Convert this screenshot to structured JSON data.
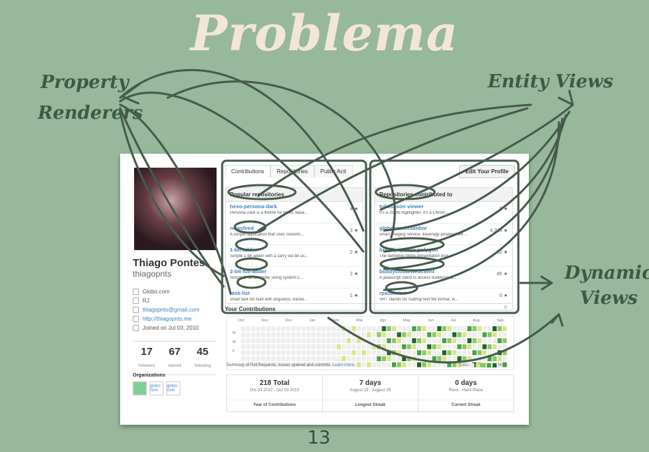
{
  "slide": {
    "title": "Problema",
    "page_number": "13",
    "annotations": {
      "property_renderers": [
        "Property",
        "Renderers"
      ],
      "entity_views": "Entity Views",
      "dynamic_views": [
        "Dynamic",
        "Views"
      ]
    }
  },
  "profile": {
    "name": "Thiago Pontes",
    "username": "thiagopnts",
    "details": [
      {
        "icon": "organization-icon",
        "text": "Globo.com",
        "link": false
      },
      {
        "icon": "location-icon",
        "text": "RJ",
        "link": false
      },
      {
        "icon": "mail-icon",
        "text": "thiagopnts@gmail.com",
        "link": true
      },
      {
        "icon": "link-icon",
        "text": "http://thiagopnts.me",
        "link": true
      },
      {
        "icon": "clock-icon",
        "text": "Joined on Jul 03, 2010",
        "link": false
      }
    ],
    "stats": [
      {
        "value": "17",
        "label": "followers"
      },
      {
        "value": "67",
        "label": "starred"
      },
      {
        "value": "45",
        "label": "following"
      }
    ],
    "organizations_label": "Organizations",
    "organizations": [
      "",
      "globo com",
      "globo com"
    ]
  },
  "tabs": [
    "Contributions",
    "Repositories",
    "Public Acti"
  ],
  "edit_profile_label": "Edit Your Profile",
  "popular_repos": {
    "header": "Popular repositories",
    "items": [
      {
        "name": "hexo-persona-dark",
        "desc": "Persona Dark is a theme for Hexo, base...",
        "stars": "4"
      },
      {
        "name": "newsfeed",
        "desc": "A simple application that uses sockets...",
        "stars": "3"
      },
      {
        "name": "1-bit-adder",
        "desc": "Simple 1-bit adder with a carry out bit us...",
        "stars": "2"
      },
      {
        "name": "2-bit-full-adder",
        "desc": "Simple 2-bit full adder using system C...",
        "stars": "2"
      },
      {
        "name": "task-list",
        "desc": "small task list built with angularjs, backe...",
        "stars": "1"
      }
    ]
  },
  "contributed_repos": {
    "header": "Repositories contributed to",
    "items": [
      {
        "name": "tulios/json-viewer",
        "desc": "It's a JSON highlighter, it's a Chrom...",
        "stars": "8"
      },
      {
        "name": "globocom/thumbor",
        "desc": "smart imaging service, keyeragy powered life ...",
        "stars": "4,329"
      },
      {
        "name": "brazilijs/power-polygon",
        "desc": "The definitive html5 presentation tool",
        "stars": "62"
      },
      {
        "name": "buddycloud/webclient",
        "desc": "A javascript client to access buddycloud...",
        "stars": "46"
      },
      {
        "name": "rpaskin/srt",
        "desc": "SRT stands for SubRip text file format, w...",
        "stars": "0"
      }
    ]
  },
  "contributions": {
    "header": "Your Contributions",
    "count": "0",
    "months": [
      "Oct",
      "Nov",
      "Dec",
      "Jan",
      "Feb",
      "Mar",
      "Apr",
      "May",
      "Jun",
      "Jul",
      "Aug",
      "Sep"
    ],
    "days": [
      "M",
      "W",
      "F"
    ],
    "summary": "Summary of Pull Requests, issues opened and commits.",
    "learn_more": "Learn more.",
    "legend_less": "Less",
    "legend_more": "More",
    "legend_colors": [
      "#eeeeee",
      "#d6e685",
      "#8cc665",
      "#44a340",
      "#1e6823"
    ]
  },
  "streaks": [
    {
      "value": "218 Total",
      "dates": "Oct 03 2012 - Oct 03 2013",
      "label": "Year of Contributions"
    },
    {
      "value": "7 days",
      "dates": "August 23 - August 29",
      "label": "Longest Streak"
    },
    {
      "value": "0 days",
      "dates": "Rock - Hard Place",
      "label": "Current Streak"
    }
  ]
}
